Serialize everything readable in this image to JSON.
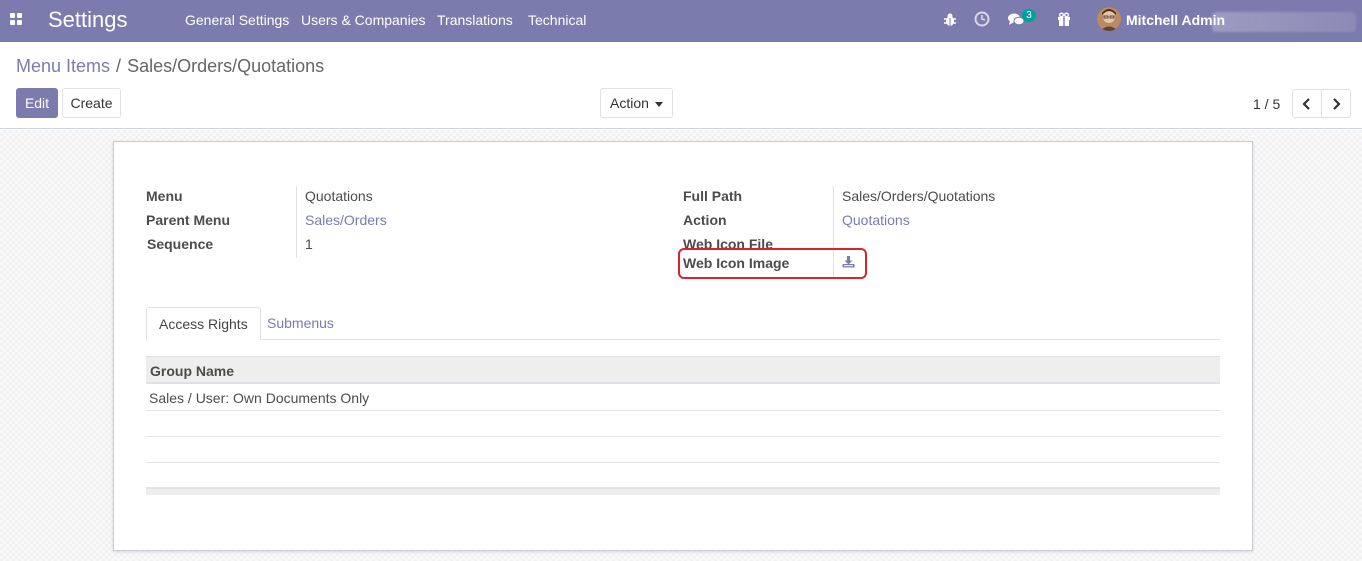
{
  "navbar": {
    "app_title": "Settings",
    "menu": [
      "General Settings",
      "Users & Companies",
      "Translations",
      "Technical"
    ],
    "chat_badge": "3",
    "user_name": "Mitchell Admin",
    "color": "#7c7bad"
  },
  "breadcrumb": {
    "parent": "Menu Items",
    "separator": "/",
    "current": "Sales/Orders/Quotations"
  },
  "buttons": {
    "edit": "Edit",
    "create": "Create",
    "action": "Action"
  },
  "pager": {
    "value": "1 / 5"
  },
  "form": {
    "left": [
      {
        "label": "Menu",
        "value": "Quotations",
        "link": false
      },
      {
        "label": "Parent Menu",
        "value": "Sales/Orders",
        "link": true
      },
      {
        "label": "Sequence",
        "value": "1",
        "link": false
      }
    ],
    "right": [
      {
        "label": "Full Path",
        "value": "Sales/Orders/Quotations",
        "link": false
      },
      {
        "label": "Action",
        "value": "Quotations",
        "link": true
      },
      {
        "label": "Web Icon File",
        "value": "",
        "link": false
      },
      {
        "label": "Web Icon Image",
        "value": "",
        "icon": "download-icon"
      }
    ],
    "highlight_color": "#d9232e"
  },
  "notebook": {
    "tabs": [
      "Access Rights",
      "Submenus"
    ],
    "active_tab": "Access Rights",
    "columns": [
      "Group Name"
    ],
    "rows": [
      [
        "Sales / User: Own Documents Only"
      ]
    ]
  }
}
